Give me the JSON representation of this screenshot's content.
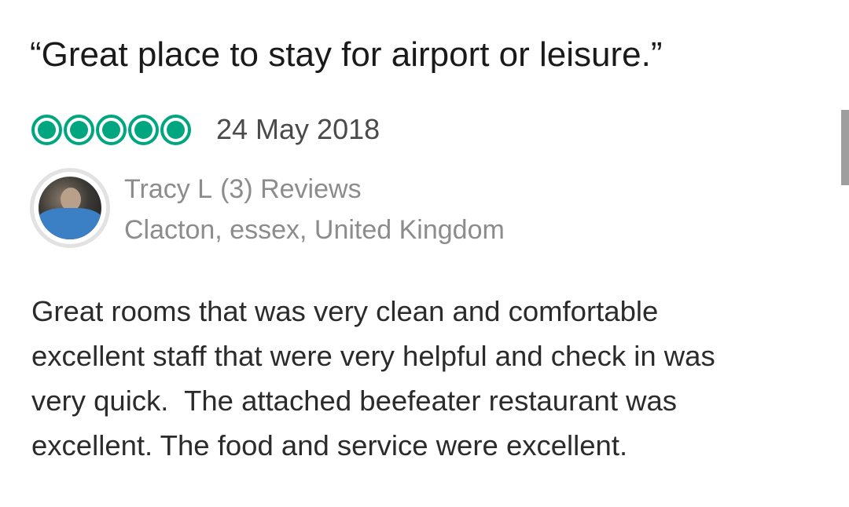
{
  "review": {
    "title": "“Great place to stay for airport or leisure.”",
    "rating": {
      "value": 5,
      "max": 5,
      "color": "#00a680",
      "icon": "rating-bubble-icon"
    },
    "date": "24 May 2018",
    "author": {
      "name": "Tracy L",
      "reviews": "(3) Reviews",
      "location": "Clacton, essex, United Kingdom"
    },
    "body": [
      "Great rooms that was very clean and comfortable",
      "excellent staff that were very helpful and check in was",
      "very quick.  The attached beefeater restaurant was",
      "excellent. The food and service were excellent."
    ]
  }
}
